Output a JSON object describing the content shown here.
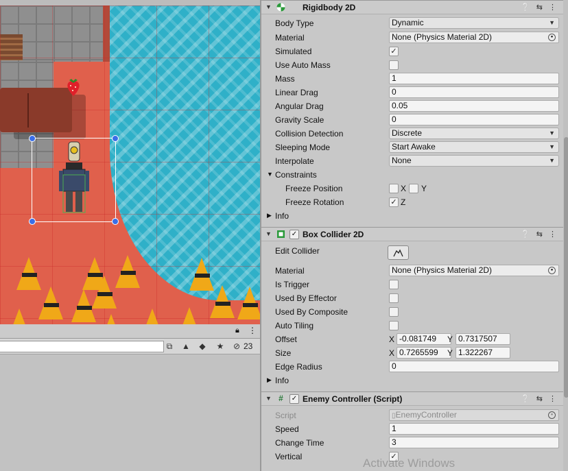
{
  "lower_panel": {
    "visible_count": "23",
    "tool_icons": [
      "picker-icon",
      "filter-type-icon",
      "label-icon",
      "favorite-star-icon",
      "visibility-eye-icon"
    ]
  },
  "rigidbody": {
    "title": "Rigidbody 2D",
    "body_type_label": "Body Type",
    "body_type": "Dynamic",
    "material_label": "Material",
    "material": "None (Physics Material 2D)",
    "simulated_label": "Simulated",
    "simulated": true,
    "use_auto_mass_label": "Use Auto Mass",
    "use_auto_mass": false,
    "mass_label": "Mass",
    "mass": "1",
    "linear_drag_label": "Linear Drag",
    "linear_drag": "0",
    "angular_drag_label": "Angular Drag",
    "angular_drag": "0.05",
    "gravity_scale_label": "Gravity Scale",
    "gravity_scale": "0",
    "collision_detection_label": "Collision Detection",
    "collision_detection": "Discrete",
    "sleeping_mode_label": "Sleeping Mode",
    "sleeping_mode": "Start Awake",
    "interpolate_label": "Interpolate",
    "interpolate": "None",
    "constraints_label": "Constraints",
    "freeze_position_label": "Freeze Position",
    "freeze_position_x_label": "X",
    "freeze_position_x": false,
    "freeze_position_y_label": "Y",
    "freeze_position_y": false,
    "freeze_rotation_label": "Freeze Rotation",
    "freeze_rotation_z_label": "Z",
    "freeze_rotation_z": true,
    "info_label": "Info"
  },
  "box_collider": {
    "title": "Box Collider 2D",
    "enabled": true,
    "edit_collider_label": "Edit Collider",
    "material_label": "Material",
    "material": "None (Physics Material 2D)",
    "is_trigger_label": "Is Trigger",
    "is_trigger": false,
    "used_by_effector_label": "Used By Effector",
    "used_by_effector": false,
    "used_by_composite_label": "Used By Composite",
    "used_by_composite": false,
    "auto_tiling_label": "Auto Tiling",
    "auto_tiling": false,
    "offset_label": "Offset",
    "offset_x_label": "X",
    "offset_x": "-0.081749",
    "offset_y_label": "Y",
    "offset_y": "0.7317507",
    "size_label": "Size",
    "size_x_label": "X",
    "size_x": "0.7265599",
    "size_y_label": "Y",
    "size_y": "1.322267",
    "edge_radius_label": "Edge Radius",
    "edge_radius": "0",
    "info_label": "Info"
  },
  "enemy_controller": {
    "title": "Enemy Controller (Script)",
    "enabled": true,
    "script_label": "Script",
    "script": "EnemyController",
    "speed_label": "Speed",
    "speed": "1",
    "change_time_label": "Change Time",
    "change_time": "3",
    "vertical_label": "Vertical",
    "vertical": true
  },
  "header_icons": [
    "help-icon",
    "presets-icon",
    "more-options-icon"
  ],
  "watermark": "Activate Windows",
  "colors": {
    "rigidbody_icon": "#2a9a3a",
    "collider_icon": "#2a9a3a",
    "selection_handle": "#3a6ee8",
    "water": "#2fb0c8",
    "floor": "#e0604c"
  }
}
